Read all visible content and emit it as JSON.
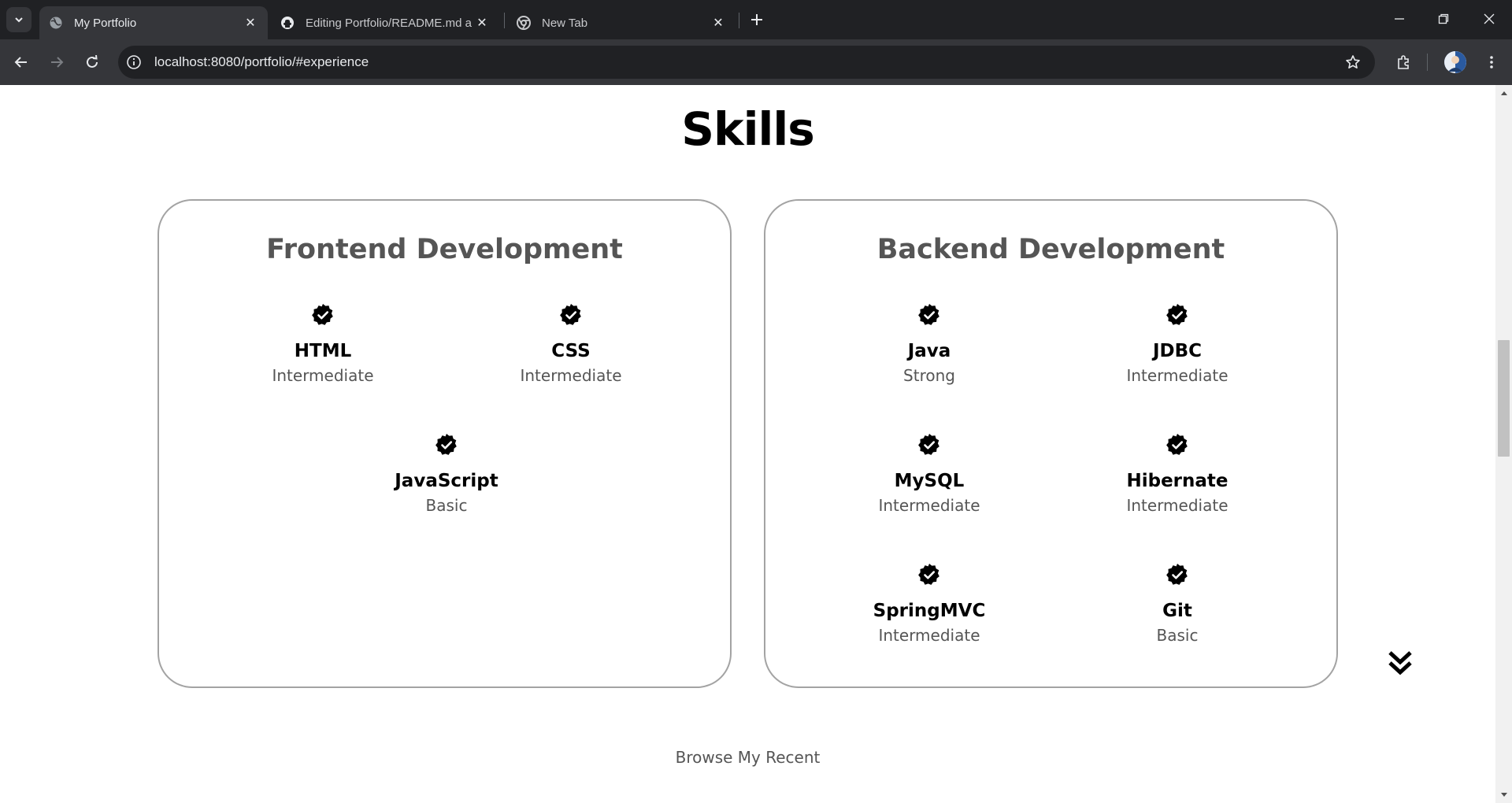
{
  "browser": {
    "tabs": [
      {
        "title": "My Portfolio",
        "active": true,
        "icon": "globe-icon"
      },
      {
        "title": "Editing Portfolio/README.md a",
        "active": false,
        "icon": "github-icon"
      },
      {
        "title": "New Tab",
        "active": false,
        "icon": "chrome-icon"
      }
    ],
    "url": "localhost:8080/portfolio/#experience"
  },
  "skills": {
    "heading": "Skills",
    "frontend": {
      "title": "Frontend Development",
      "items": [
        {
          "name": "HTML",
          "level": "Intermediate"
        },
        {
          "name": "CSS",
          "level": "Intermediate"
        },
        {
          "name": "JavaScript",
          "level": "Basic"
        }
      ]
    },
    "backend": {
      "title": "Backend Development",
      "items": [
        {
          "name": "Java",
          "level": "Strong"
        },
        {
          "name": "JDBC",
          "level": "Intermediate"
        },
        {
          "name": "MySQL",
          "level": "Intermediate"
        },
        {
          "name": "Hibernate",
          "level": "Intermediate"
        },
        {
          "name": "SpringMVC",
          "level": "Intermediate"
        },
        {
          "name": "Git",
          "level": "Basic"
        }
      ]
    }
  },
  "next_section": {
    "text": "Browse My Recent"
  },
  "colors": {
    "heading": "#000000",
    "subtext": "#555555",
    "card_border": "#a3a3a3",
    "chrome_dark": "#202124",
    "chrome_mid": "#35363a"
  }
}
